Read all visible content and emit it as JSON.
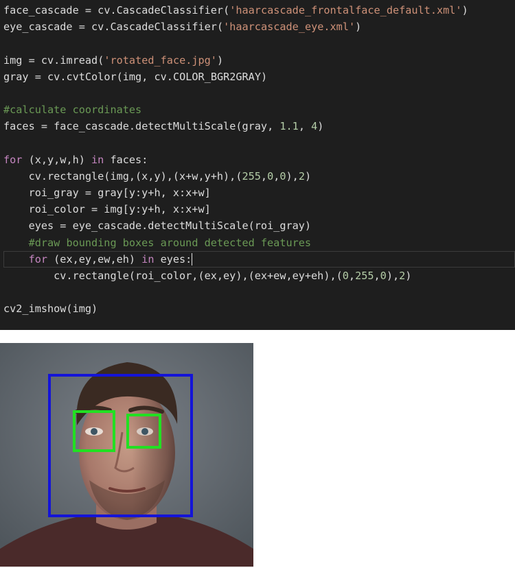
{
  "code_lines": [
    [
      {
        "t": "face_cascade",
        "c": "t-id"
      },
      {
        "t": " = ",
        "c": "t-id"
      },
      {
        "t": "cv",
        "c": "t-id"
      },
      {
        "t": ".",
        "c": "t-id"
      },
      {
        "t": "CascadeClassifier",
        "c": "t-id"
      },
      {
        "t": "(",
        "c": "t-id"
      },
      {
        "t": "'haarcascade_frontalface_default.xml'",
        "c": "t-str"
      },
      {
        "t": ")",
        "c": "t-id"
      }
    ],
    [
      {
        "t": "eye_cascade",
        "c": "t-id"
      },
      {
        "t": " = ",
        "c": "t-id"
      },
      {
        "t": "cv",
        "c": "t-id"
      },
      {
        "t": ".",
        "c": "t-id"
      },
      {
        "t": "CascadeClassifier",
        "c": "t-id"
      },
      {
        "t": "(",
        "c": "t-id"
      },
      {
        "t": "'haarcascade_eye.xml'",
        "c": "t-str"
      },
      {
        "t": ")",
        "c": "t-id"
      }
    ],
    [],
    [
      {
        "t": "img",
        "c": "t-id"
      },
      {
        "t": " = ",
        "c": "t-id"
      },
      {
        "t": "cv",
        "c": "t-id"
      },
      {
        "t": ".",
        "c": "t-id"
      },
      {
        "t": "imread",
        "c": "t-id"
      },
      {
        "t": "(",
        "c": "t-id"
      },
      {
        "t": "'rotated_face.jpg'",
        "c": "t-str"
      },
      {
        "t": ")",
        "c": "t-id"
      }
    ],
    [
      {
        "t": "gray",
        "c": "t-id"
      },
      {
        "t": " = ",
        "c": "t-id"
      },
      {
        "t": "cv",
        "c": "t-id"
      },
      {
        "t": ".",
        "c": "t-id"
      },
      {
        "t": "cvtColor",
        "c": "t-id"
      },
      {
        "t": "(img, ",
        "c": "t-id"
      },
      {
        "t": "cv",
        "c": "t-id"
      },
      {
        "t": ".",
        "c": "t-id"
      },
      {
        "t": "COLOR_BGR2GRAY",
        "c": "t-id"
      },
      {
        "t": ")",
        "c": "t-id"
      }
    ],
    [],
    [
      {
        "t": "#calculate coordinates",
        "c": "t-com"
      }
    ],
    [
      {
        "t": "faces",
        "c": "t-id"
      },
      {
        "t": " = ",
        "c": "t-id"
      },
      {
        "t": "face_cascade",
        "c": "t-id"
      },
      {
        "t": ".",
        "c": "t-id"
      },
      {
        "t": "detectMultiScale",
        "c": "t-id"
      },
      {
        "t": "(gray, ",
        "c": "t-id"
      },
      {
        "t": "1.1",
        "c": "t-num"
      },
      {
        "t": ", ",
        "c": "t-id"
      },
      {
        "t": "4",
        "c": "t-num"
      },
      {
        "t": ")",
        "c": "t-id"
      }
    ],
    [],
    [
      {
        "t": "for",
        "c": "t-kw"
      },
      {
        "t": " (x,y,w,h) ",
        "c": "t-id"
      },
      {
        "t": "in",
        "c": "t-kw"
      },
      {
        "t": " faces:",
        "c": "t-id"
      }
    ],
    [
      {
        "t": "    cv.rectangle(img,(x,y),(x+w,y+h),(",
        "c": "t-id"
      },
      {
        "t": "255",
        "c": "t-num"
      },
      {
        "t": ",",
        "c": "t-id"
      },
      {
        "t": "0",
        "c": "t-num"
      },
      {
        "t": ",",
        "c": "t-id"
      },
      {
        "t": "0",
        "c": "t-num"
      },
      {
        "t": "),",
        "c": "t-id"
      },
      {
        "t": "2",
        "c": "t-num"
      },
      {
        "t": ")",
        "c": "t-id"
      }
    ],
    [
      {
        "t": "    roi_gray = gray[y:y+h, x:x+w]",
        "c": "t-id"
      }
    ],
    [
      {
        "t": "    roi_color = img[y:y+h, x:x+w]",
        "c": "t-id"
      }
    ],
    [
      {
        "t": "    eyes = eye_cascade.detectMultiScale(roi_gray)",
        "c": "t-id"
      }
    ],
    [
      {
        "t": "    ",
        "c": "t-id"
      },
      {
        "t": "#draw bounding boxes around detected features",
        "c": "t-com"
      }
    ],
    [
      {
        "t": "    ",
        "c": "t-id"
      },
      {
        "t": "for",
        "c": "t-kw"
      },
      {
        "t": " (ex,ey,ew,eh) ",
        "c": "t-id"
      },
      {
        "t": "in",
        "c": "t-kw"
      },
      {
        "t": " eyes:",
        "c": "t-id"
      }
    ],
    [
      {
        "t": "        cv.rectangle(roi_color,(ex,ey),(ex+ew,ey+eh),(",
        "c": "t-id"
      },
      {
        "t": "0",
        "c": "t-num"
      },
      {
        "t": ",",
        "c": "t-id"
      },
      {
        "t": "255",
        "c": "t-num"
      },
      {
        "t": ",",
        "c": "t-id"
      },
      {
        "t": "0",
        "c": "t-num"
      },
      {
        "t": "),",
        "c": "t-id"
      },
      {
        "t": "2",
        "c": "t-num"
      },
      {
        "t": ")",
        "c": "t-id"
      }
    ],
    [],
    [
      {
        "t": "cv2_imshow(img)",
        "c": "t-id"
      }
    ]
  ],
  "current_line_index": 15,
  "colors": {
    "editor_bg": "#1e1e1e",
    "face_box": "#1414d8",
    "eye_box": "#22e022"
  },
  "image": {
    "subject": "face photo with detection boxes",
    "face_boxes": 1,
    "eye_boxes": 2
  }
}
